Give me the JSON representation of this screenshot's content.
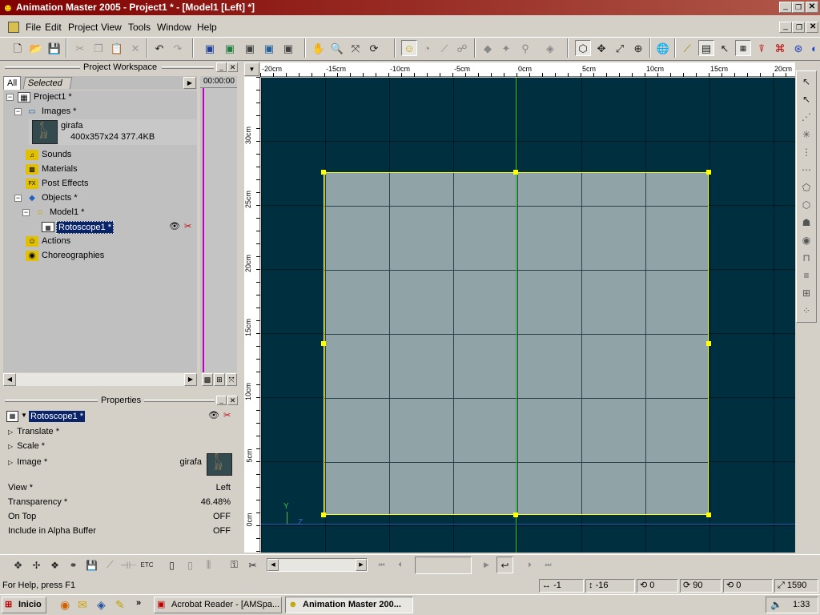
{
  "window": {
    "title": "Animation Master 2005 - Project1 * - [Model1 [Left] *]"
  },
  "menu": {
    "items": [
      "File",
      "Edit",
      "Project",
      "View",
      "Tools",
      "Window",
      "Help"
    ]
  },
  "workspace": {
    "title": "Project Workspace",
    "tabs": {
      "all": "All",
      "selected": "Selected"
    },
    "timecode": "00:00:00",
    "tree": {
      "project": "Project1 *",
      "images": "Images *",
      "image_name": "girafa",
      "image_info": "400x357x24 377.4KB",
      "sounds": "Sounds",
      "materials": "Materials",
      "post_effects": "Post Effects",
      "objects": "Objects *",
      "model": "Model1 *",
      "rotoscope": "Rotoscope1 *",
      "actions": "Actions",
      "choreographies": "Choreographies"
    }
  },
  "properties": {
    "title": "Properties",
    "name": "Rotoscope1 *",
    "rows": {
      "translate": "Translate *",
      "scale": "Scale *",
      "image_label": "Image *",
      "image_value": "girafa",
      "view_label": "View *",
      "view_value": "Left",
      "transparency_label": "Transparency *",
      "transparency_value": "46.48%",
      "ontop_label": "On Top",
      "ontop_value": "OFF",
      "alpha_label": "Include in Alpha Buffer",
      "alpha_value": "OFF"
    }
  },
  "ruler": {
    "h": [
      "-20cm",
      "-15cm",
      "-10cm",
      "-5cm",
      "0cm",
      "5cm",
      "10cm",
      "15cm",
      "20cm"
    ],
    "v": [
      "30cm",
      "25cm",
      "20cm",
      "15cm",
      "10cm",
      "5cm",
      "0cm"
    ]
  },
  "axis": {
    "y": "Y",
    "z": "Z"
  },
  "statusbar": {
    "help": "For Help, press F1",
    "x": "-1",
    "y": "-16",
    "rot1": "0",
    "rot2": "90",
    "rot3": "0",
    "zoom": "1590"
  },
  "taskbar": {
    "start": "Inicio",
    "more": "»",
    "task1": "Acrobat Reader - [AMSpa...",
    "task2": "Animation Master 200...",
    "clock": "1:33"
  },
  "colors": {
    "viewport": "#003040",
    "roto": "#90a4a8",
    "selection": "#ffff00",
    "title_bar": "#800000"
  }
}
